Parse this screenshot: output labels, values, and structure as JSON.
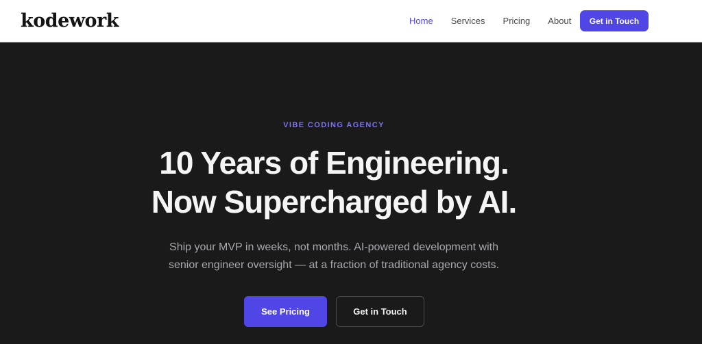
{
  "nav": {
    "logo": "kodework",
    "links": [
      {
        "label": "Home",
        "active": true
      },
      {
        "label": "Services",
        "active": false
      },
      {
        "label": "Pricing",
        "active": false
      },
      {
        "label": "About",
        "active": false
      }
    ],
    "cta_label": "Get in Touch"
  },
  "hero": {
    "eyebrow": "VIBE CODING AGENCY",
    "headline_line1": "10 Years of Engineering.",
    "headline_line2": "Now Supercharged by AI.",
    "subtitle_line1": "Ship your MVP in weeks, not months. AI-powered development with",
    "subtitle_line2": "senior engineer oversight — at a fraction of traditional agency costs.",
    "primary_button": "See Pricing",
    "secondary_button": "Get in Touch"
  },
  "colors": {
    "accent": "#4f46e5",
    "accent_light": "#7b74f5",
    "hero_background": "#1a1a1b",
    "nav_background": "#ffffff"
  }
}
